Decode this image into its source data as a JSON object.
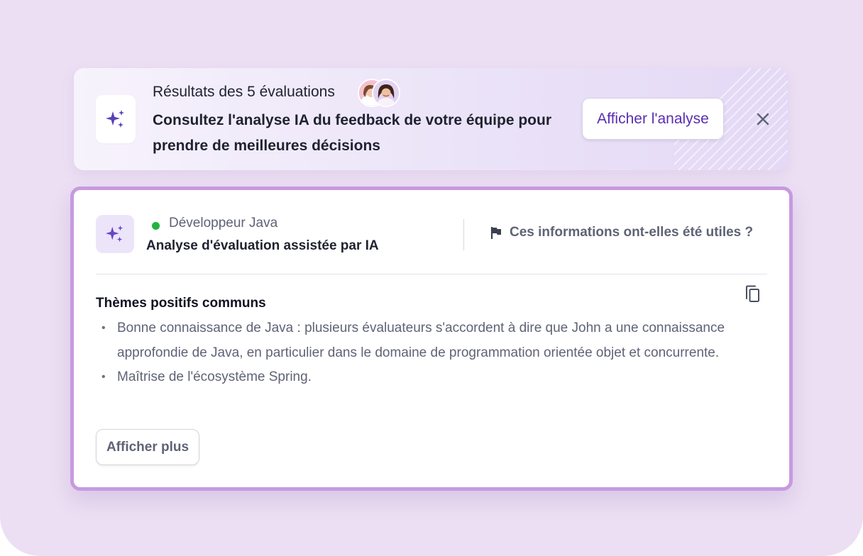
{
  "banner": {
    "eyebrow": "Résultats des 5 évaluations",
    "headline": "Consultez l'analyse IA du feedback de votre équipe pour prendre de meilleures décisions",
    "action_label": "Afficher l'analyse",
    "icon": "sparkles-icon",
    "close_icon": "close-icon",
    "avatars": [
      "reviewer-avatar",
      "reviewer-avatar"
    ]
  },
  "card": {
    "role": "Développeur Java",
    "status_color": "#22b43c",
    "title": "Analyse d'évaluation assistée par IA",
    "feedback_question": "Ces informations ont-elles été utiles ?",
    "feedback_icon": "flag-icon",
    "copy_icon": "copy-icon",
    "section_title": "Thèmes positifs communs",
    "bullets": [
      "Bonne connaissance de Java : plusieurs évaluateurs s'accordent à dire que John a une connaissance approfondie de Java, en particulier dans le domaine de programmation orientée objet et concurrente.",
      "Maîtrise de l'écosystème Spring."
    ],
    "more_label": "Afficher plus",
    "border_color": "#c79ae0"
  },
  "colors": {
    "background": "#ecdff3",
    "accent": "#5a2fb0",
    "sparkle": "#6a45c8"
  }
}
